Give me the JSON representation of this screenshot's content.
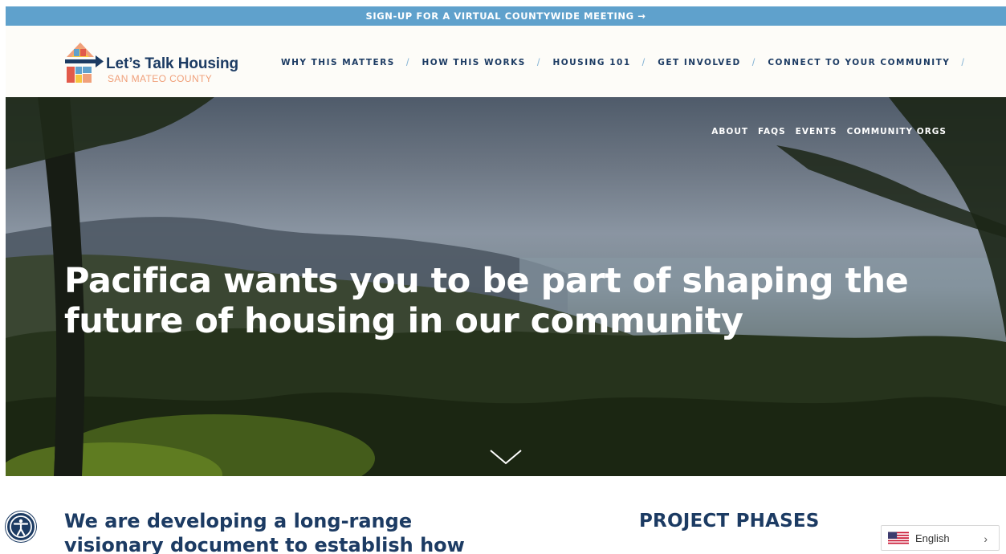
{
  "banner": {
    "text": "SIGN-UP FOR A VIRTUAL COUNTYWIDE MEETING →"
  },
  "logo": {
    "title": "Let’s Talk Housing",
    "subtitle": "SAN MATEO COUNTY"
  },
  "nav": {
    "items": [
      {
        "label": "WHY THIS MATTERS"
      },
      {
        "label": "HOW THIS WORKS"
      },
      {
        "label": "HOUSING 101"
      },
      {
        "label": "GET INVOLVED"
      },
      {
        "label": "CONNECT TO YOUR COMMUNITY"
      }
    ],
    "separator": "/"
  },
  "subnav": {
    "items": [
      {
        "label": "ABOUT"
      },
      {
        "label": "FAQS"
      },
      {
        "label": "EVENTS"
      },
      {
        "label": "COMMUNITY ORGS"
      }
    ]
  },
  "hero": {
    "title": "Pacifica wants you to be part of shaping the future of housing in our community",
    "scroll_icon": "chevron-down-icon"
  },
  "main": {
    "intro_heading": "We are developing a long-range visionary document to establish how",
    "phases_heading": "PROJECT PHASES"
  },
  "accessibility": {
    "icon": "accessibility-icon"
  },
  "language": {
    "selected": "English",
    "flag_icon": "us-flag-icon",
    "chevron_icon": "chevron-right-icon"
  },
  "colors": {
    "banner": "#5fa1cc",
    "navy": "#1c3b63",
    "header_bg": "#fdfcf8",
    "separator": "#8ab6d6",
    "logo_sub": "#f0a07a"
  }
}
